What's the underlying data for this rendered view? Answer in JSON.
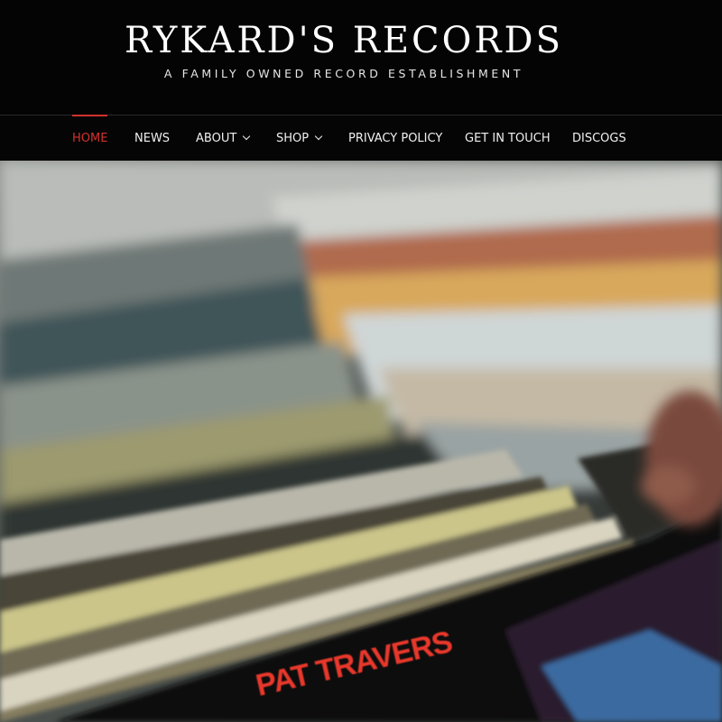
{
  "header": {
    "title": "RYKARD'S RECORDS",
    "tagline": "A FAMILY OWNED RECORD ESTABLISHMENT"
  },
  "nav": {
    "items": [
      {
        "label": "HOME",
        "active": true,
        "has_dropdown": false
      },
      {
        "label": "NEWS",
        "active": false,
        "has_dropdown": false
      },
      {
        "label": "ABOUT",
        "active": false,
        "has_dropdown": true
      },
      {
        "label": "SHOP",
        "active": false,
        "has_dropdown": true
      },
      {
        "label": "PRIVACY POLICY",
        "active": false,
        "has_dropdown": false
      },
      {
        "label": "GET IN TOUCH",
        "active": false,
        "has_dropdown": false
      },
      {
        "label": "DISCOGS",
        "active": false,
        "has_dropdown": false
      }
    ],
    "active_color": "#d2322d"
  },
  "hero": {
    "album_text": "PAT TRAVERS"
  }
}
